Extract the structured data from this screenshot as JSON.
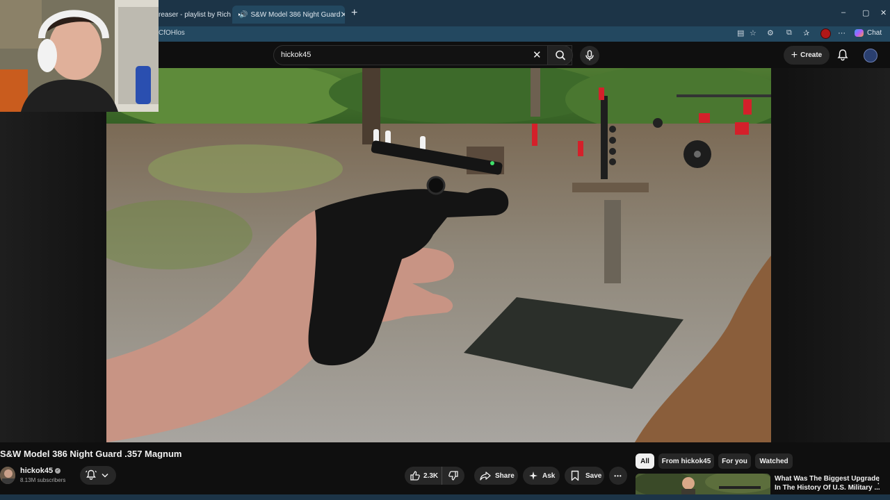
{
  "browser": {
    "tabs": [
      {
        "label": "reaser - playlist by Rich",
        "close": "✕"
      },
      {
        "label": "S&W Model 386 Night Guard",
        "close": "✕"
      }
    ],
    "new_tab": "+",
    "address": "CfOHlos",
    "chat_label": "Chat",
    "window_controls": {
      "minimize": "–",
      "maximize": "▢",
      "close": "✕"
    }
  },
  "youtube": {
    "search": {
      "value": "hickok45",
      "clear": "✕"
    },
    "create_label": "Create",
    "video": {
      "title": "S&W Model 386 Night Guard .357 Magnum",
      "channel": "hickok45",
      "subscribers": "8.13M subscribers",
      "verified": "✓"
    },
    "actions": {
      "likes": "2.3K",
      "share": "Share",
      "ask": "Ask",
      "save": "Save",
      "more": "•••"
    },
    "chips": [
      "All",
      "From hickok45",
      "For you",
      "Watched"
    ],
    "recommendation": {
      "title_line1": "What Was The Biggest Upgrade",
      "title_line2": "In The History Of U.S. Military ...",
      "more": "⋮"
    }
  },
  "colors": {
    "tab_bar": "#1c3447",
    "address_bar": "#234860",
    "page_bg": "#0f0f0f",
    "pill_bg": "#272727",
    "youtube_red": "#ff0000"
  }
}
